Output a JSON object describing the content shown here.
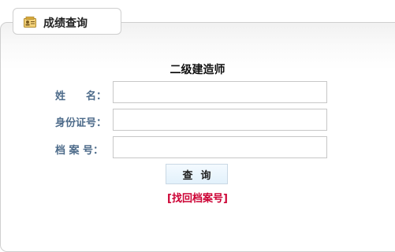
{
  "tab": {
    "icon": "id-card-icon",
    "title": "成绩查询"
  },
  "form": {
    "exam_title": "二级建造师",
    "fields": [
      {
        "label": "姓　　名：",
        "value": "",
        "placeholder": ""
      },
      {
        "label": "身份证号：",
        "value": "",
        "placeholder": ""
      },
      {
        "label": "档 案 号：",
        "value": "",
        "placeholder": ""
      }
    ],
    "query_button": "查询",
    "recover_link": "[找回档案号]"
  },
  "colors": {
    "label": "#4d6b8a",
    "link": "#cc0033",
    "border": "#cfcfcf",
    "button_bg": "#e2f1fb"
  }
}
